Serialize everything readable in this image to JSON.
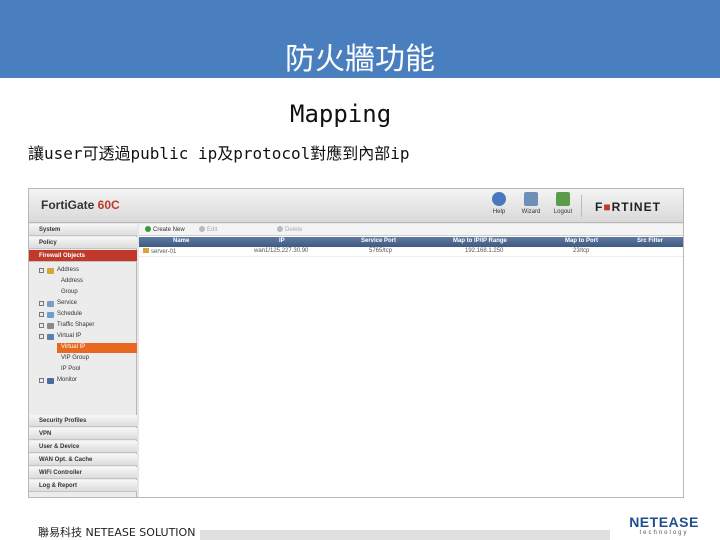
{
  "slide": {
    "title": "防火牆功能",
    "subtitle": "Mapping",
    "description": "讓user可透過public ip及protocol對應到內部ip",
    "footer_text": "聯易科技 NETEASE SOLUTION",
    "brand_name": "NETEASE",
    "brand_tagline": "technology"
  },
  "fortigate": {
    "model_prefix": "FortiGate ",
    "model_highlight": "60C",
    "top_buttons": [
      {
        "label": "Help",
        "icon": "help-icon"
      },
      {
        "label": "Wizard",
        "icon": "wizard-icon"
      },
      {
        "label": "Logout",
        "icon": "logout-icon"
      }
    ],
    "logo_pre": "F",
    "logo_mark": "■",
    "logo_post": "RTINET",
    "sidebar_top": [
      "System",
      "Policy",
      "Firewall Objects"
    ],
    "tree": [
      {
        "label": "Address",
        "level": 0,
        "expand": "minus"
      },
      {
        "label": "Address",
        "level": 1
      },
      {
        "label": "Group",
        "level": 1
      },
      {
        "label": "Service",
        "level": 0,
        "expand": "plus"
      },
      {
        "label": "Schedule",
        "level": 0,
        "expand": "plus"
      },
      {
        "label": "Traffic Shaper",
        "level": 0,
        "expand": "plus"
      },
      {
        "label": "Virtual IP",
        "level": 0,
        "expand": "minus"
      },
      {
        "label": "Virtual IP",
        "level": 1,
        "selected": true
      },
      {
        "label": "VIP Group",
        "level": 1
      },
      {
        "label": "IP Pool",
        "level": 1
      },
      {
        "label": "Monitor",
        "level": 0,
        "expand": "plus"
      }
    ],
    "sidebar_bottom": [
      "Security Profiles",
      "VPN",
      "User & Device",
      "WAN Opt. & Cache",
      "WiFi Controller",
      "Log & Report"
    ],
    "toolbar": {
      "create_new": "Create New",
      "edit": "Edit",
      "delete": "Delete"
    },
    "table": {
      "columns": [
        "Name",
        "IP",
        "Service Port",
        "Map to IP/IP Range",
        "Map to Port",
        "Src Filter"
      ],
      "rows": [
        [
          "server-01",
          "wan1/125.227.30.90",
          "5765/tcp",
          "192.168.1.250",
          "23/tcp",
          ""
        ]
      ]
    },
    "colors": {
      "accent": "#c0392b",
      "selected": "#e8681f",
      "header": "#4a7fbf"
    }
  }
}
